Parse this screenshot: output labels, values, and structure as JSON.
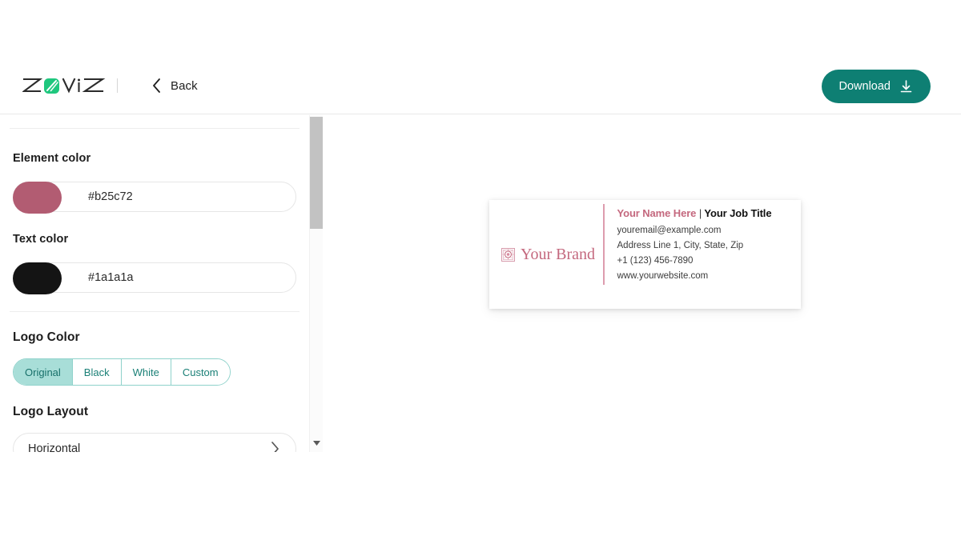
{
  "header": {
    "brand_logo": "zoviz-logo",
    "brand_text": "ZOVIZ",
    "back_label": "Back",
    "back_icon": "chevron-left-icon",
    "download_label": "Download",
    "download_icon": "download-icon",
    "download_bg": "#0e7f73"
  },
  "panel": {
    "element_color": {
      "label": "Element color",
      "value": "#b25c72",
      "swatch": "#b25c72"
    },
    "text_color": {
      "label": "Text color",
      "value": "#1a1a1a",
      "swatch": "#1a1a1a"
    },
    "logo_color": {
      "label": "Logo Color",
      "options": [
        "Original",
        "Black",
        "White",
        "Custom"
      ],
      "selected": "Original",
      "accent": "#a8ded8"
    },
    "logo_layout": {
      "label": "Logo Layout",
      "value": "Horizontal",
      "chevron_icon": "chevron-right-icon"
    }
  },
  "scrollbar": {
    "thumb_icon": "scroll-thumb",
    "arrow_icon": "triangle-down-icon"
  },
  "preview": {
    "brand": {
      "emblem_icon": "ornate-square-emblem-icon",
      "name": "Your Brand",
      "color": "#c4687e"
    },
    "signature": {
      "name": "Your Name Here",
      "separator": "|",
      "job_title": "Your Job Title",
      "email": "youremail@example.com",
      "address": "Address Line 1, City, State, Zip",
      "phone": "+1 (123) 456-7890",
      "website": "www.yourwebsite.com"
    }
  }
}
